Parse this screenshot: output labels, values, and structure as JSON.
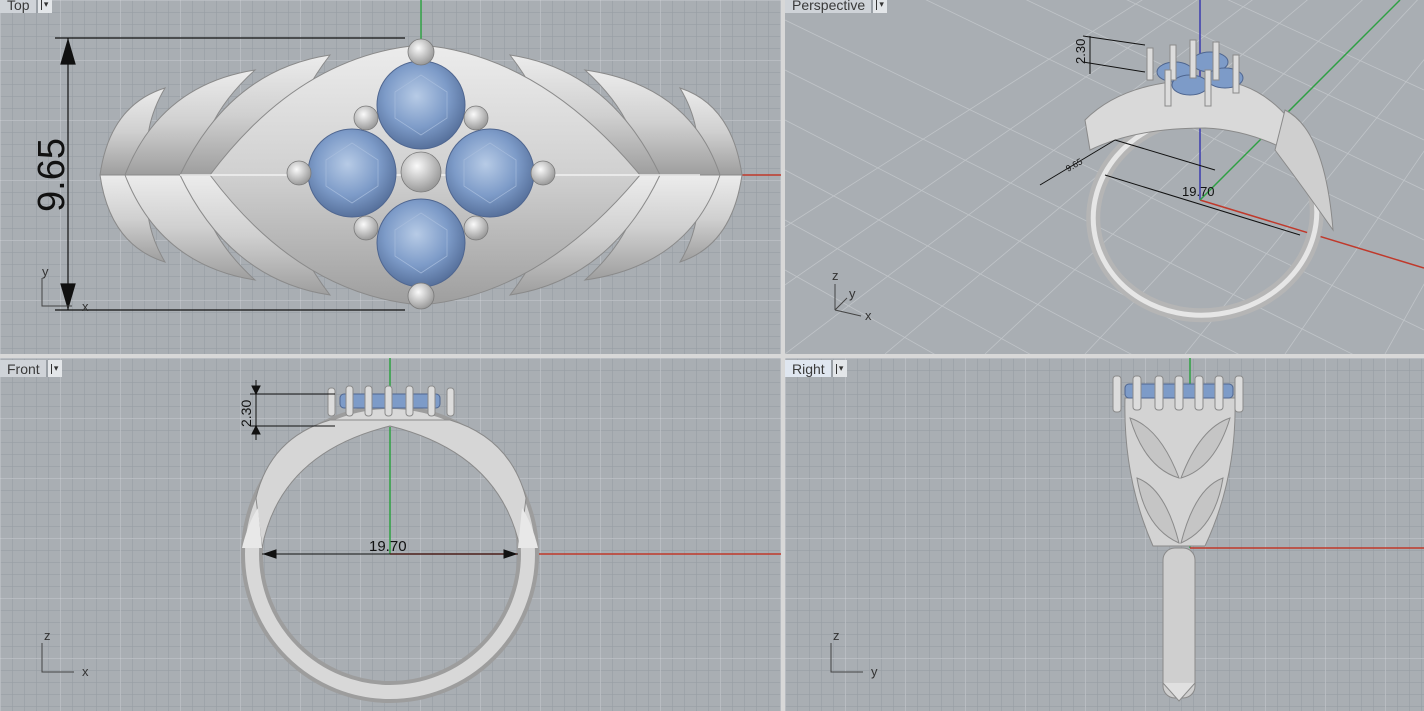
{
  "viewports": {
    "top": {
      "label": "Top",
      "dim_vertical": "9.65",
      "axis_x": "x",
      "axis_y": "y"
    },
    "perspective": {
      "label": "Perspective",
      "dim_height": "2.30",
      "dim_small": "9.65",
      "dim_diameter": "19.70",
      "axis_x": "x",
      "axis_y": "y",
      "axis_z": "z"
    },
    "front": {
      "label": "Front",
      "dim_height": "2.30",
      "dim_diameter": "19.70",
      "axis_x": "x",
      "axis_z": "z"
    },
    "right": {
      "label": "Right",
      "axis_y": "y",
      "axis_z": "z"
    }
  },
  "icons": {
    "dropdown": "chevron-down-icon",
    "gizmo": "axis-gizmo-icon"
  },
  "colors": {
    "viewport_bg": "#a9aeb3",
    "metal": "#d6d6d6",
    "gem": "#7d9bc8",
    "axis_x": "#c0392b",
    "axis_y": "#2ea043",
    "axis_z": "#3b3bb0"
  }
}
